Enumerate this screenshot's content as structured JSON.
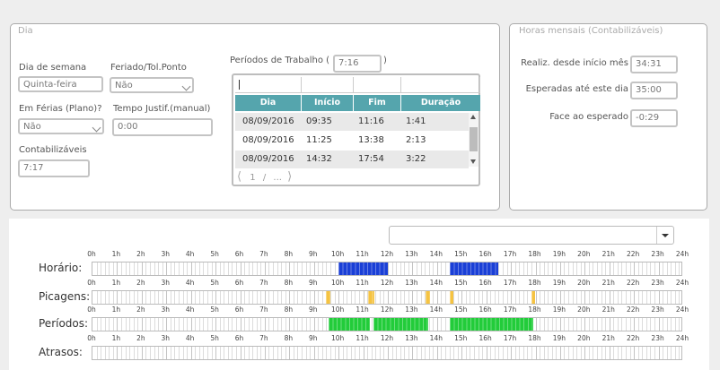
{
  "dia": {
    "title": "Dia",
    "dia_semana": {
      "label": "Dia de semana",
      "value": "Quinta-feira"
    },
    "feriado": {
      "label": "Feriado/Tol.Ponto",
      "value": "Não"
    },
    "ferias": {
      "label": "Em Férias (Plano)?",
      "value": "Não"
    },
    "tempo_justif": {
      "label": "Tempo Justif.(manual)",
      "value": "0:00"
    },
    "contabilizaveis": {
      "label": "Contabilizáveis",
      "value": "7:17"
    },
    "periodos": {
      "label_prefix": "Períodos de Trabalho (",
      "label_suffix": ")",
      "total": "7:16",
      "columns": [
        "Dia",
        "Início",
        "Fim",
        "Duração"
      ],
      "rows": [
        [
          "08/09/2016",
          "09:35",
          "11:16",
          "1:41"
        ],
        [
          "08/09/2016",
          "11:25",
          "13:38",
          "2:13"
        ],
        [
          "08/09/2016",
          "14:32",
          "17:54",
          "3:22"
        ]
      ],
      "pager": {
        "page": "1",
        "sep": "/",
        "total": "..."
      }
    }
  },
  "horas": {
    "title": "Horas mensais (Contabilizáveis)",
    "realiz": {
      "label": "Realiz. desde início mês",
      "value": "34:31"
    },
    "esperadas": {
      "label": "Esperadas até este dia",
      "value": "35:00"
    },
    "face": {
      "label": "Face ao esperado",
      "value": "-0:29"
    }
  },
  "timeline": {
    "dropdown_value": "",
    "hours": [
      "0h",
      "1h",
      "2h",
      "3h",
      "4h",
      "5h",
      "6h",
      "7h",
      "8h",
      "9h",
      "10h",
      "11h",
      "12h",
      "13h",
      "14h",
      "15h",
      "16h",
      "17h",
      "18h",
      "19h",
      "20h",
      "21h",
      "22h",
      "23h",
      "24h"
    ],
    "colors": {
      "horario": "#1a3fd6",
      "picagens": "#f5c342",
      "periodos": "#22cc3a"
    },
    "rows": [
      {
        "label": "Horário:",
        "kind": "horario",
        "segments": [
          [
            10.0,
            12.0
          ],
          [
            14.5,
            16.5
          ]
        ]
      },
      {
        "label": "Picagens:",
        "kind": "picagens",
        "segments": [
          [
            9.5,
            9.65
          ],
          [
            11.2,
            11.45
          ],
          [
            13.55,
            13.7
          ],
          [
            14.5,
            14.65
          ],
          [
            17.85,
            18.0
          ]
        ]
      },
      {
        "label": "Períodos:",
        "kind": "periodos",
        "segments": [
          [
            9.5833,
            11.2667
          ],
          [
            11.4167,
            13.6333
          ],
          [
            14.5333,
            17.9
          ]
        ]
      },
      {
        "label": "Atrasos:",
        "kind": "atrasos",
        "segments": []
      }
    ]
  }
}
